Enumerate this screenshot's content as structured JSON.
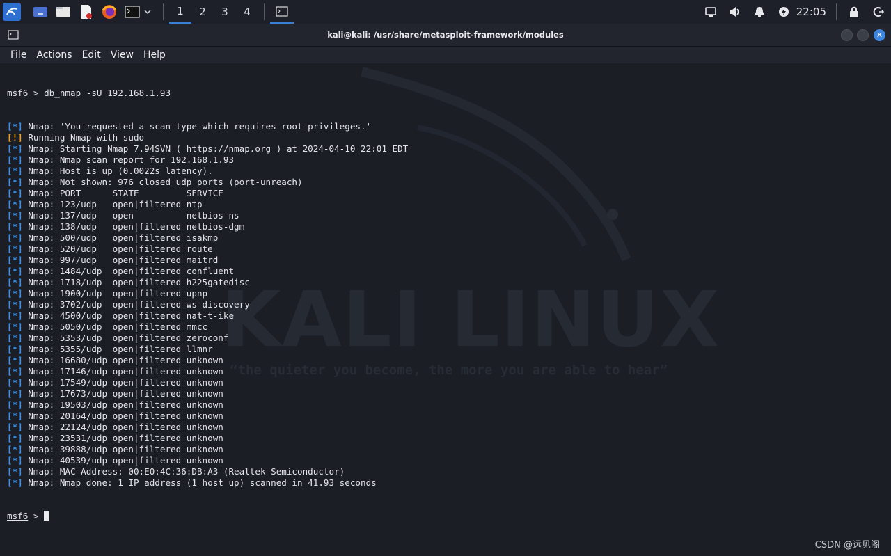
{
  "taskbar": {
    "workspaces": [
      "1",
      "2",
      "3",
      "4"
    ],
    "clock": "22:05"
  },
  "window": {
    "title": "kali@kali: /usr/share/metasploit-framework/modules"
  },
  "menu": [
    "File",
    "Actions",
    "Edit",
    "View",
    "Help"
  ],
  "terminal": {
    "prompt_name": "msf6",
    "prompt_suffix": " > ",
    "command": "db_nmap -sU 192.168.1.93",
    "output": [
      {
        "tag": "[*]",
        "text": " Nmap: 'You requested a scan type which requires root privileges.'"
      },
      {
        "tag": "[!]",
        "text": " Running Nmap with sudo"
      },
      {
        "tag": "[*]",
        "text": " Nmap: Starting Nmap 7.94SVN ( https://nmap.org ) at 2024-04-10 22:01 EDT"
      },
      {
        "tag": "[*]",
        "text": " Nmap: Nmap scan report for 192.168.1.93"
      },
      {
        "tag": "[*]",
        "text": " Nmap: Host is up (0.0022s latency)."
      },
      {
        "tag": "[*]",
        "text": " Nmap: Not shown: 976 closed udp ports (port-unreach)"
      },
      {
        "tag": "[*]",
        "text": " Nmap: PORT      STATE         SERVICE"
      },
      {
        "tag": "[*]",
        "text": " Nmap: 123/udp   open|filtered ntp"
      },
      {
        "tag": "[*]",
        "text": " Nmap: 137/udp   open          netbios-ns"
      },
      {
        "tag": "[*]",
        "text": " Nmap: 138/udp   open|filtered netbios-dgm"
      },
      {
        "tag": "[*]",
        "text": " Nmap: 500/udp   open|filtered isakmp"
      },
      {
        "tag": "[*]",
        "text": " Nmap: 520/udp   open|filtered route"
      },
      {
        "tag": "[*]",
        "text": " Nmap: 997/udp   open|filtered maitrd"
      },
      {
        "tag": "[*]",
        "text": " Nmap: 1484/udp  open|filtered confluent"
      },
      {
        "tag": "[*]",
        "text": " Nmap: 1718/udp  open|filtered h225gatedisc"
      },
      {
        "tag": "[*]",
        "text": " Nmap: 1900/udp  open|filtered upnp"
      },
      {
        "tag": "[*]",
        "text": " Nmap: 3702/udp  open|filtered ws-discovery"
      },
      {
        "tag": "[*]",
        "text": " Nmap: 4500/udp  open|filtered nat-t-ike"
      },
      {
        "tag": "[*]",
        "text": " Nmap: 5050/udp  open|filtered mmcc"
      },
      {
        "tag": "[*]",
        "text": " Nmap: 5353/udp  open|filtered zeroconf"
      },
      {
        "tag": "[*]",
        "text": " Nmap: 5355/udp  open|filtered llmnr"
      },
      {
        "tag": "[*]",
        "text": " Nmap: 16680/udp open|filtered unknown"
      },
      {
        "tag": "[*]",
        "text": " Nmap: 17146/udp open|filtered unknown"
      },
      {
        "tag": "[*]",
        "text": " Nmap: 17549/udp open|filtered unknown"
      },
      {
        "tag": "[*]",
        "text": " Nmap: 17673/udp open|filtered unknown"
      },
      {
        "tag": "[*]",
        "text": " Nmap: 19503/udp open|filtered unknown"
      },
      {
        "tag": "[*]",
        "text": " Nmap: 20164/udp open|filtered unknown"
      },
      {
        "tag": "[*]",
        "text": " Nmap: 22124/udp open|filtered unknown"
      },
      {
        "tag": "[*]",
        "text": " Nmap: 23531/udp open|filtered unknown"
      },
      {
        "tag": "[*]",
        "text": " Nmap: 39888/udp open|filtered unknown"
      },
      {
        "tag": "[*]",
        "text": " Nmap: 40539/udp open|filtered unknown"
      },
      {
        "tag": "[*]",
        "text": " Nmap: MAC Address: 00:E0:4C:36:DB:A3 (Realtek Semiconductor)"
      },
      {
        "tag": "[*]",
        "text": " Nmap: Nmap done: 1 IP address (1 host up) scanned in 41.93 seconds"
      }
    ],
    "colors": {
      "info": "#3f8fe8",
      "warn": "#f0a020"
    }
  },
  "wallpaper": {
    "logo_text": "KALI LINUX",
    "tagline": "“the quieter you become, the more you are able to hear”"
  },
  "watermark": "CSDN @远见阁"
}
